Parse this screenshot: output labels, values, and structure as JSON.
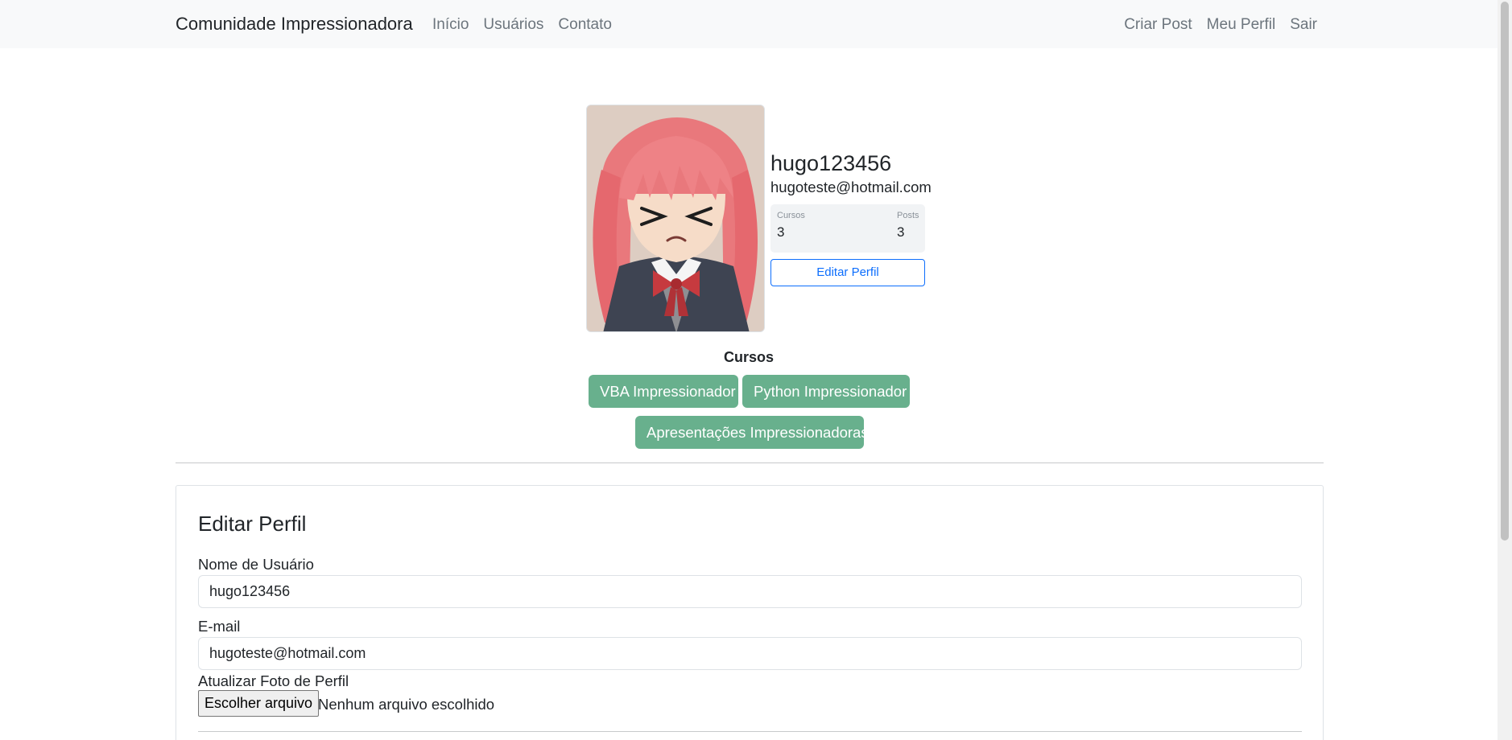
{
  "navbar": {
    "brand": "Comunidade Impressionadora",
    "left_links": [
      "Início",
      "Usuários",
      "Contato"
    ],
    "right_links": [
      "Criar Post",
      "Meu Perfil",
      "Sair"
    ]
  },
  "profile": {
    "username": "hugo123456",
    "email": "hugoteste@hotmail.com",
    "stats": {
      "courses_label": "Cursos",
      "courses_value": "3",
      "posts_label": "Posts",
      "posts_value": "3"
    },
    "edit_button": "Editar Perfil"
  },
  "courses": {
    "title": "Cursos",
    "items": [
      "VBA Impressionador",
      "Python Impressionador",
      "Apresentações Impressionadoras"
    ]
  },
  "form": {
    "legend": "Editar Perfil",
    "username_label": "Nome de Usuário",
    "username_value": "hugo123456",
    "email_label": "E-mail",
    "email_value": "hugoteste@hotmail.com",
    "photo_label": "Atualizar Foto de Perfil",
    "file_button": "Escolher arquivo",
    "file_status": "Nenhum arquivo escolhido"
  },
  "colors": {
    "navbar_bg": "#f8f9fa",
    "course_button": "#68b08d",
    "primary": "#0d6efd"
  }
}
